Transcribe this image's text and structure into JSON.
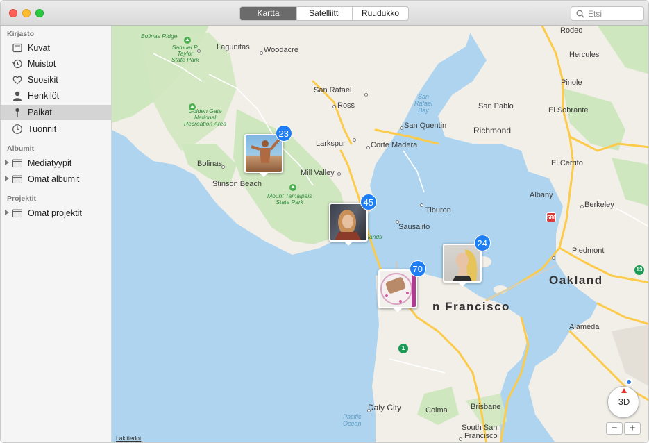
{
  "toolbar": {
    "tabs": [
      "Kartta",
      "Satelliitti",
      "Ruudukko"
    ],
    "active_tab": "Kartta",
    "search_placeholder": "Etsi"
  },
  "sidebar": {
    "sections": [
      {
        "title": "Kirjasto"
      },
      {
        "title": "Albumit"
      },
      {
        "title": "Projektit"
      }
    ],
    "library_items": [
      {
        "label": "Kuvat",
        "icon": "photos-icon"
      },
      {
        "label": "Muistot",
        "icon": "memories-icon"
      },
      {
        "label": "Suosikit",
        "icon": "heart-icon"
      },
      {
        "label": "Henkilöt",
        "icon": "person-icon"
      },
      {
        "label": "Paikat",
        "icon": "pin-icon",
        "selected": true
      },
      {
        "label": "Tuonnit",
        "icon": "clock-icon"
      }
    ],
    "album_items": [
      {
        "label": "Mediatyypit",
        "icon": "folder-icon"
      },
      {
        "label": "Omat albumit",
        "icon": "folder-icon"
      }
    ],
    "project_items": [
      {
        "label": "Omat projektit",
        "icon": "folder-icon"
      }
    ]
  },
  "map": {
    "place_labels": {
      "rodeo": "Rodeo",
      "hercules": "Hercules",
      "pinole": "Pinole",
      "san_pablo": "San Pablo",
      "el_sobrante": "El Sobrante",
      "richmond": "Richmond",
      "el_cerrito": "El Cerrito",
      "albany": "Albany",
      "berkeley": "Berkeley",
      "piedmont": "Piedmont",
      "oakland": "Oakland",
      "alameda": "Alameda",
      "lagunitas": "Lagunitas",
      "woodacre": "Woodacre",
      "san_rafael": "San Rafael",
      "ross": "Ross",
      "san_quentin": "San Quentin",
      "larkspur": "Larkspur",
      "corte_madera": "Corte Madera",
      "mill_valley": "Mill Valley",
      "bolinas": "Bolinas",
      "stinson_beach": "Stinson Beach",
      "tiburon": "Tiburon",
      "sausalito": "Sausalito",
      "san_francisco": "n Francisco",
      "daly_city": "Daly City",
      "colma": "Colma",
      "brisbane": "Brisbane",
      "south_san": "South San",
      "francisco_bottom": "Francisco",
      "bolinas_ridge": "Bolinas Ridge",
      "samuel_taylor": "Samuel P.\nTaylor\nState Park",
      "golden_gate": "Golden Gate\nNational\nRecreation Area",
      "mount_tam": "Mount Tamalpais\nState Park",
      "lands": "lands",
      "san_rafael_bay": "San\nRafael\nBay",
      "pacific_ocean": "Pacific\nOcean"
    },
    "route_shields": {
      "i580": "580",
      "hw1": "1",
      "hw13": "13"
    },
    "photo_pins": [
      {
        "count": "23",
        "subject": "person-swimming"
      },
      {
        "count": "45",
        "subject": "woman-portrait"
      },
      {
        "count": "70",
        "subject": "food-plate"
      },
      {
        "count": "24",
        "subject": "woman-profile"
      }
    ],
    "compass_label": "3D",
    "zoom_out": "−",
    "zoom_in": "+",
    "legal_link": "Lakitiedot"
  },
  "colors": {
    "water": "#aed4ef",
    "land": "#f2efe8",
    "park": "#cfe7bf",
    "highway": "#fccb4b",
    "badge": "#1f7ef3",
    "selected_row": "#d4d4d4"
  }
}
